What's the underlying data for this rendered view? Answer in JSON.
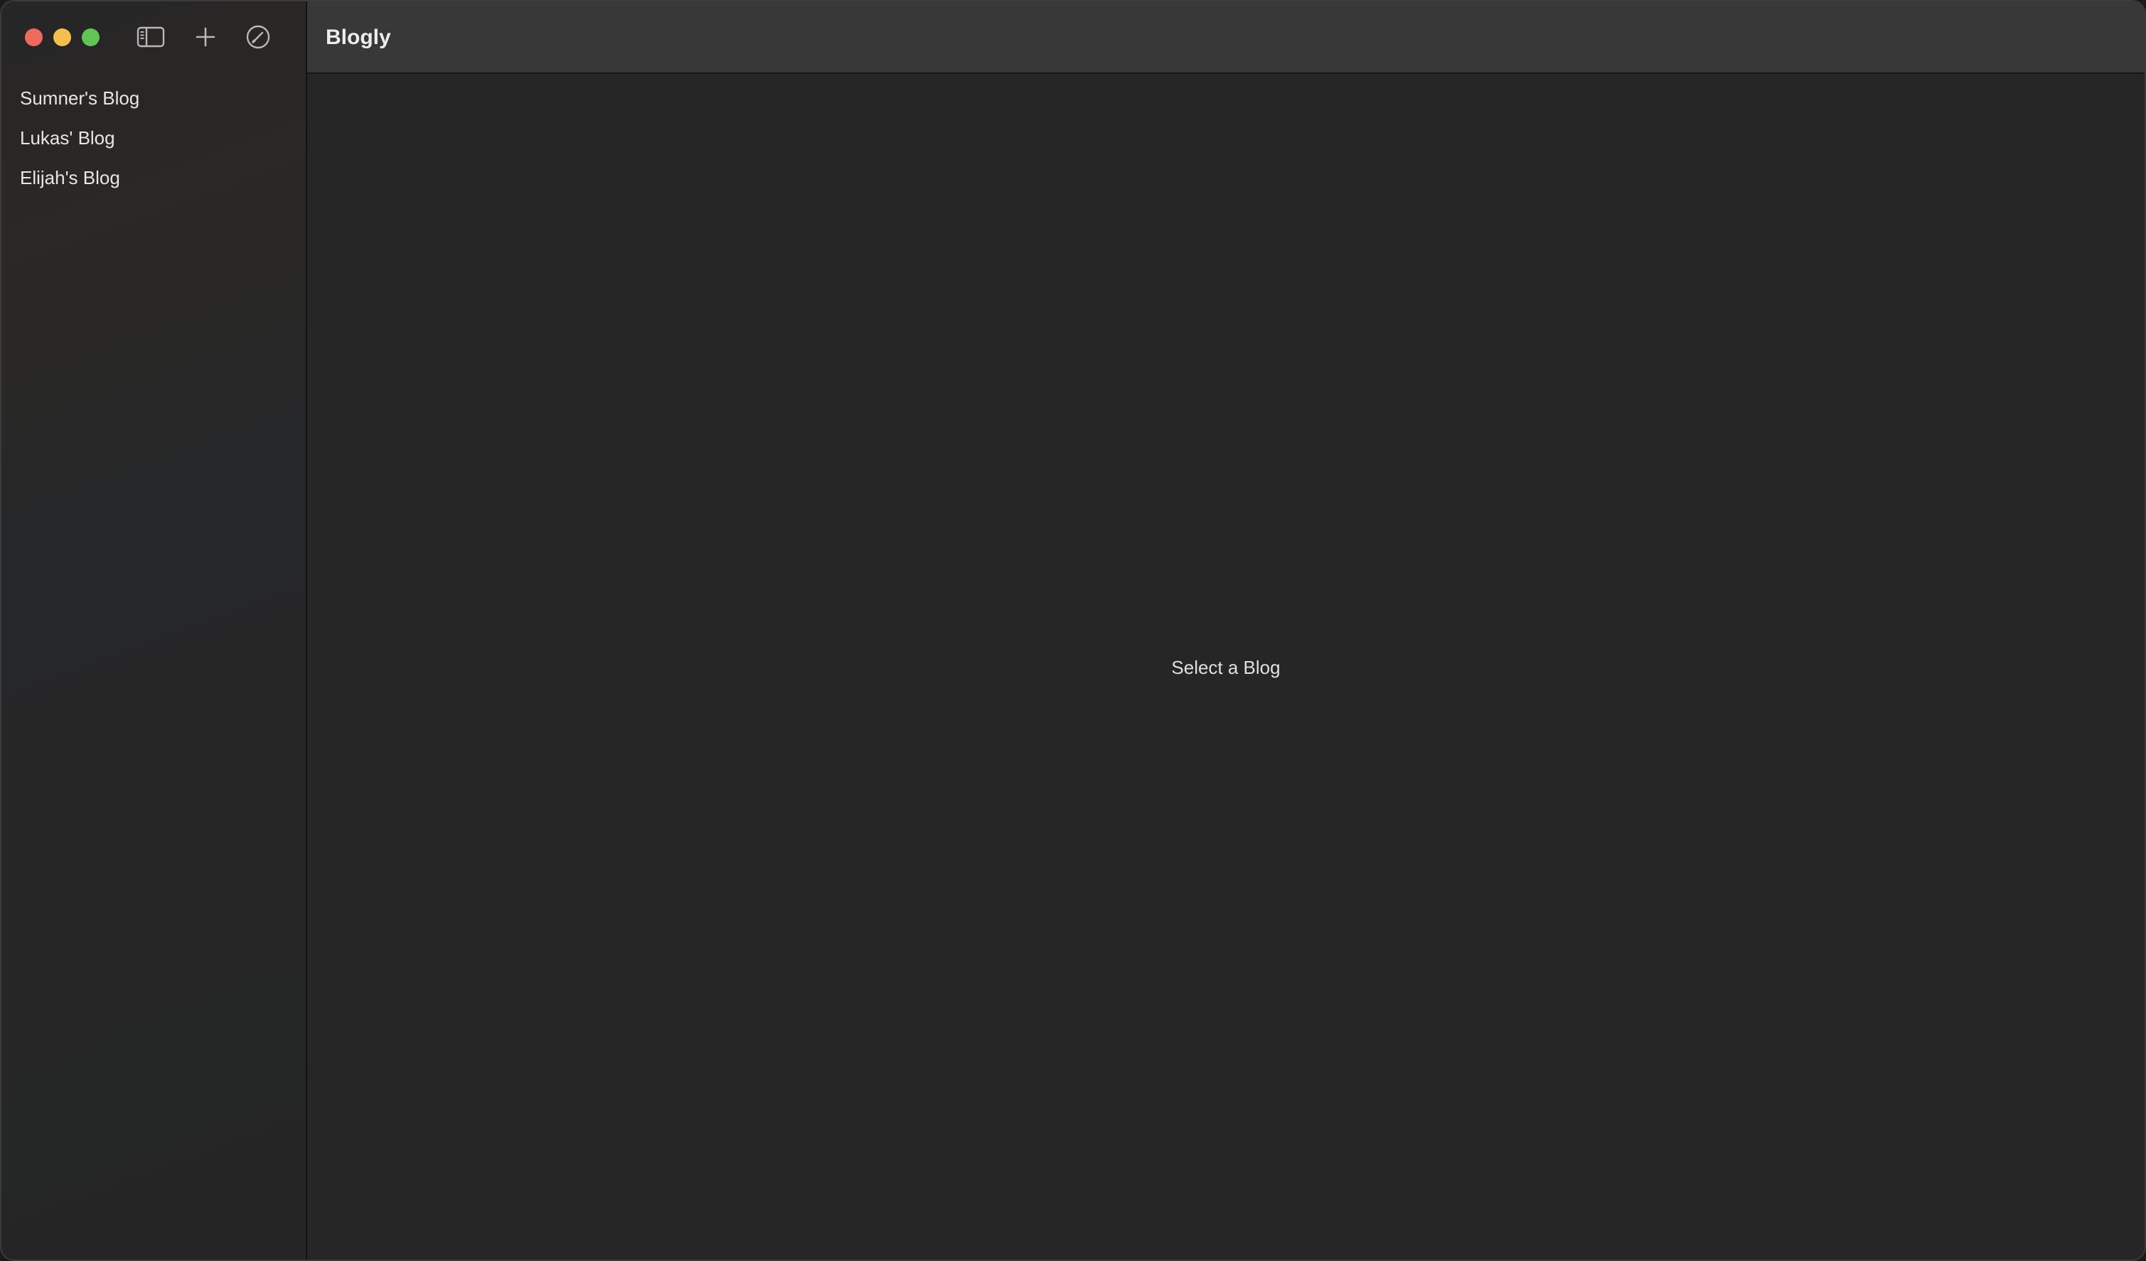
{
  "window": {
    "title": "Blogly",
    "controls": [
      "close-icon",
      "minimize-icon",
      "maximize-icon"
    ]
  },
  "toolbar": {
    "icons": [
      "sidebar-toggle-icon",
      "plus-icon",
      "compose-icon"
    ]
  },
  "sidebar": {
    "items": [
      {
        "label": "Sumner's Blog"
      },
      {
        "label": "Lukas' Blog"
      },
      {
        "label": "Elijah's Blog"
      }
    ]
  },
  "main": {
    "placeholder": "Select a Blog"
  },
  "colors": {
    "close": "#ed6a5e",
    "minimize": "#f5bf4f",
    "maximize": "#61c454",
    "background": "#262626",
    "titlebar": "#383838"
  }
}
